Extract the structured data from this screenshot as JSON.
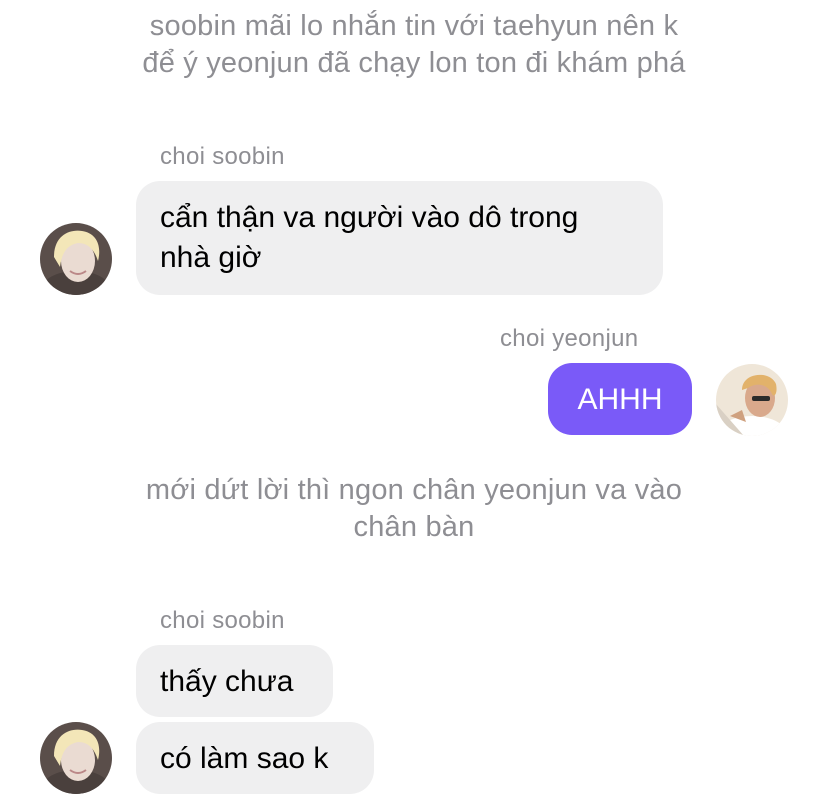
{
  "colors": {
    "background": "#ffffff",
    "narration_text": "#8e8e93",
    "incoming_bubble": "#efeff0",
    "outgoing_bubble": "#7a5af8",
    "outgoing_text": "#ffffff"
  },
  "narration": [
    {
      "lines": [
        "soobin mãi lo nhắn tin với taehyun nên k",
        "để ý yeonjun đã chạy lon ton đi khám phá"
      ]
    },
    {
      "lines": [
        "mới dứt lời thì ngon chân yeonjun va vào",
        "chân bàn"
      ]
    }
  ],
  "messages": [
    {
      "sender": "choi soobin",
      "lines": [
        "cẩn thận va người vào dô trong",
        "nhà giờ"
      ],
      "side": "incoming"
    },
    {
      "sender": "choi yeonjun",
      "text": "AHHH",
      "side": "outgoing"
    },
    {
      "sender": "choi soobin",
      "text": "thấy chưa",
      "side": "incoming"
    },
    {
      "text": "có làm sao k",
      "side": "incoming"
    }
  ],
  "avatars": {
    "soobin": "avatar-soobin-photo",
    "yeonjun": "avatar-yeonjun-photo"
  }
}
